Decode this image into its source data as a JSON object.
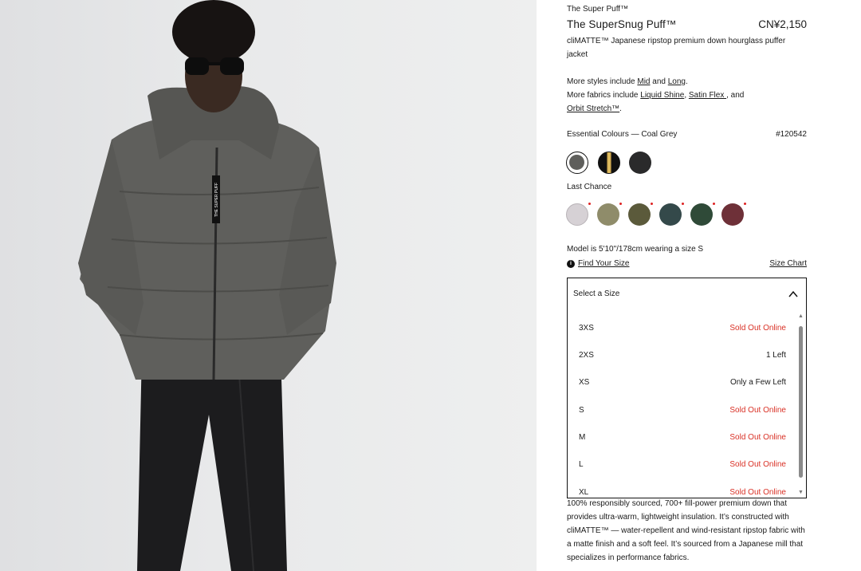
{
  "product": {
    "collection": "The Super Puff™",
    "name": "The SuperSnug Puff™",
    "price": "CN¥2,150",
    "description": "cliMATTE™ Japanese ripstop premium down hourglass puffer jacket"
  },
  "more_styles": {
    "prefix": "More styles include ",
    "link1": "Mid",
    "and": " and ",
    "link2": "Long",
    "end": "."
  },
  "more_fabrics": {
    "prefix": "More fabrics include ",
    "link1": "Liquid Shine",
    "sep1": ", ",
    "link2": "Satin Flex ",
    "sep2": ", and ",
    "link3": "Orbit Stretch™",
    "end": "."
  },
  "colours": {
    "label": "Essential Colours — Coal Grey",
    "style_number": "#120542",
    "essential": [
      {
        "name": "coal-grey",
        "color": "#5f5f5c",
        "selected": true
      },
      {
        "name": "black-gold",
        "color": "#141414",
        "selected": false
      },
      {
        "name": "black",
        "color": "#2a2a2b",
        "selected": false
      }
    ],
    "last_chance_label": "Last Chance",
    "last_chance": [
      {
        "name": "lilac-grey",
        "color": "#d6d1d5"
      },
      {
        "name": "sage",
        "color": "#8f8c6a"
      },
      {
        "name": "olive",
        "color": "#5b5a3b"
      },
      {
        "name": "deep-teal",
        "color": "#34494a"
      },
      {
        "name": "forest",
        "color": "#2f4a38"
      },
      {
        "name": "burgundy",
        "color": "#6e3038"
      }
    ]
  },
  "sizing": {
    "model_note": "Model is 5'10\"/178cm wearing a size S",
    "find_your_size": "Find Your Size",
    "size_chart": "Size Chart",
    "select_label": "Select a Size",
    "options": [
      {
        "size": "3XS",
        "status": "Sold Out Online",
        "sold_out": true
      },
      {
        "size": "2XS",
        "status": "1 Left",
        "sold_out": false
      },
      {
        "size": "XS",
        "status": "Only a Few Left",
        "sold_out": false
      },
      {
        "size": "S",
        "status": "Sold Out Online",
        "sold_out": true
      },
      {
        "size": "M",
        "status": "Sold Out Online",
        "sold_out": true
      },
      {
        "size": "L",
        "status": "Sold Out Online",
        "sold_out": true
      },
      {
        "size": "XL",
        "status": "Sold Out Online",
        "sold_out": true
      }
    ]
  },
  "details": "100% responsibly sourced, 700+ fill-power premium down that provides ultra-warm, lightweight insulation. It’s constructed with cliMATTE™ — water-repellent and wind-resistant ripstop fabric with a matte finish and a soft feel. It’s sourced from a Japanese mill that specializes in performance fabrics.",
  "photo": {
    "jacket_label": "THE SUPER PUFF"
  },
  "icons": {
    "find_size": "info-icon",
    "dropdown": "chevron-up-icon",
    "scroll_up": "scroll-up-arrow-icon",
    "scroll_down": "scroll-down-arrow-icon"
  },
  "theme": {
    "sold_out_color": "#d93025",
    "border_color": "#111111"
  }
}
